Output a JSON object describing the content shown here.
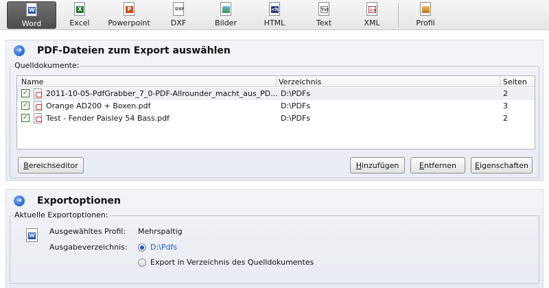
{
  "toolbar": {
    "items": [
      {
        "label": "Word",
        "icon": "word-icon",
        "badge": "W",
        "color": "#2a56a8"
      },
      {
        "label": "Excel",
        "icon": "excel-icon",
        "badge": "X",
        "color": "#1e7b34"
      },
      {
        "label": "Powerpoint",
        "icon": "powerpoint-icon",
        "badge": "P",
        "color": "#d04a1a"
      },
      {
        "label": "DXF",
        "icon": "dxf-icon",
        "badge": "DXF",
        "color": "#555555"
      },
      {
        "label": "Bilder",
        "icon": "image-icon",
        "badge": "",
        "color": "#3f8fd0"
      },
      {
        "label": "HTML",
        "icon": "html-icon",
        "badge": "<h",
        "color": "#2a3f7a"
      },
      {
        "label": "Text",
        "icon": "text-icon",
        "badge": "Txt",
        "color": "#555555"
      },
      {
        "label": "XML",
        "icon": "xml-icon",
        "badge": "<x",
        "color": "#b03030"
      },
      {
        "label": "Profil",
        "icon": "profile-icon",
        "badge": "",
        "color": "#c07020"
      }
    ],
    "active": "Word"
  },
  "section1": {
    "title": "PDF-Dateien zum Export auswählen",
    "group_label": "Quelldokumente:",
    "columns": [
      "Name",
      "Verzeichnis",
      "Seiten"
    ],
    "rows": [
      {
        "name": "2011-10-05-PdfGrabber_7_0-PDF-Allrounder_macht_aus_PD...",
        "dir": "D:\\PDFs",
        "pages": "2",
        "checked": true
      },
      {
        "name": "Orange AD200 + Boxen.pdf",
        "dir": "D:\\PDFs",
        "pages": "3",
        "checked": true
      },
      {
        "name": "Test - Fender Paisley 54 Bass.pdf",
        "dir": "D:\\PDFs",
        "pages": "2",
        "checked": true
      }
    ],
    "buttons": {
      "range_editor_u": "B",
      "range_editor": "ereichseditor",
      "add_u": "H",
      "add": "inzufügen",
      "remove_u": "E",
      "remove": "ntfernen",
      "properties_u": "E",
      "properties": "igenschaften"
    }
  },
  "section2": {
    "title": "Exportoptionen",
    "group_label": "Aktuelle Exportoptionen:",
    "profile_label": "Ausgewähltes Profil:",
    "profile_value": "Mehrspaltig",
    "output_label": "Ausgabeverzeichnis:",
    "output_option1": "D:\\Pdfs",
    "output_option2": "Export in Verzeichnis des Quelldokumentes",
    "selected_option": 1
  },
  "colors": {
    "link": "#1f56c7",
    "check": "#1f7a1f"
  }
}
